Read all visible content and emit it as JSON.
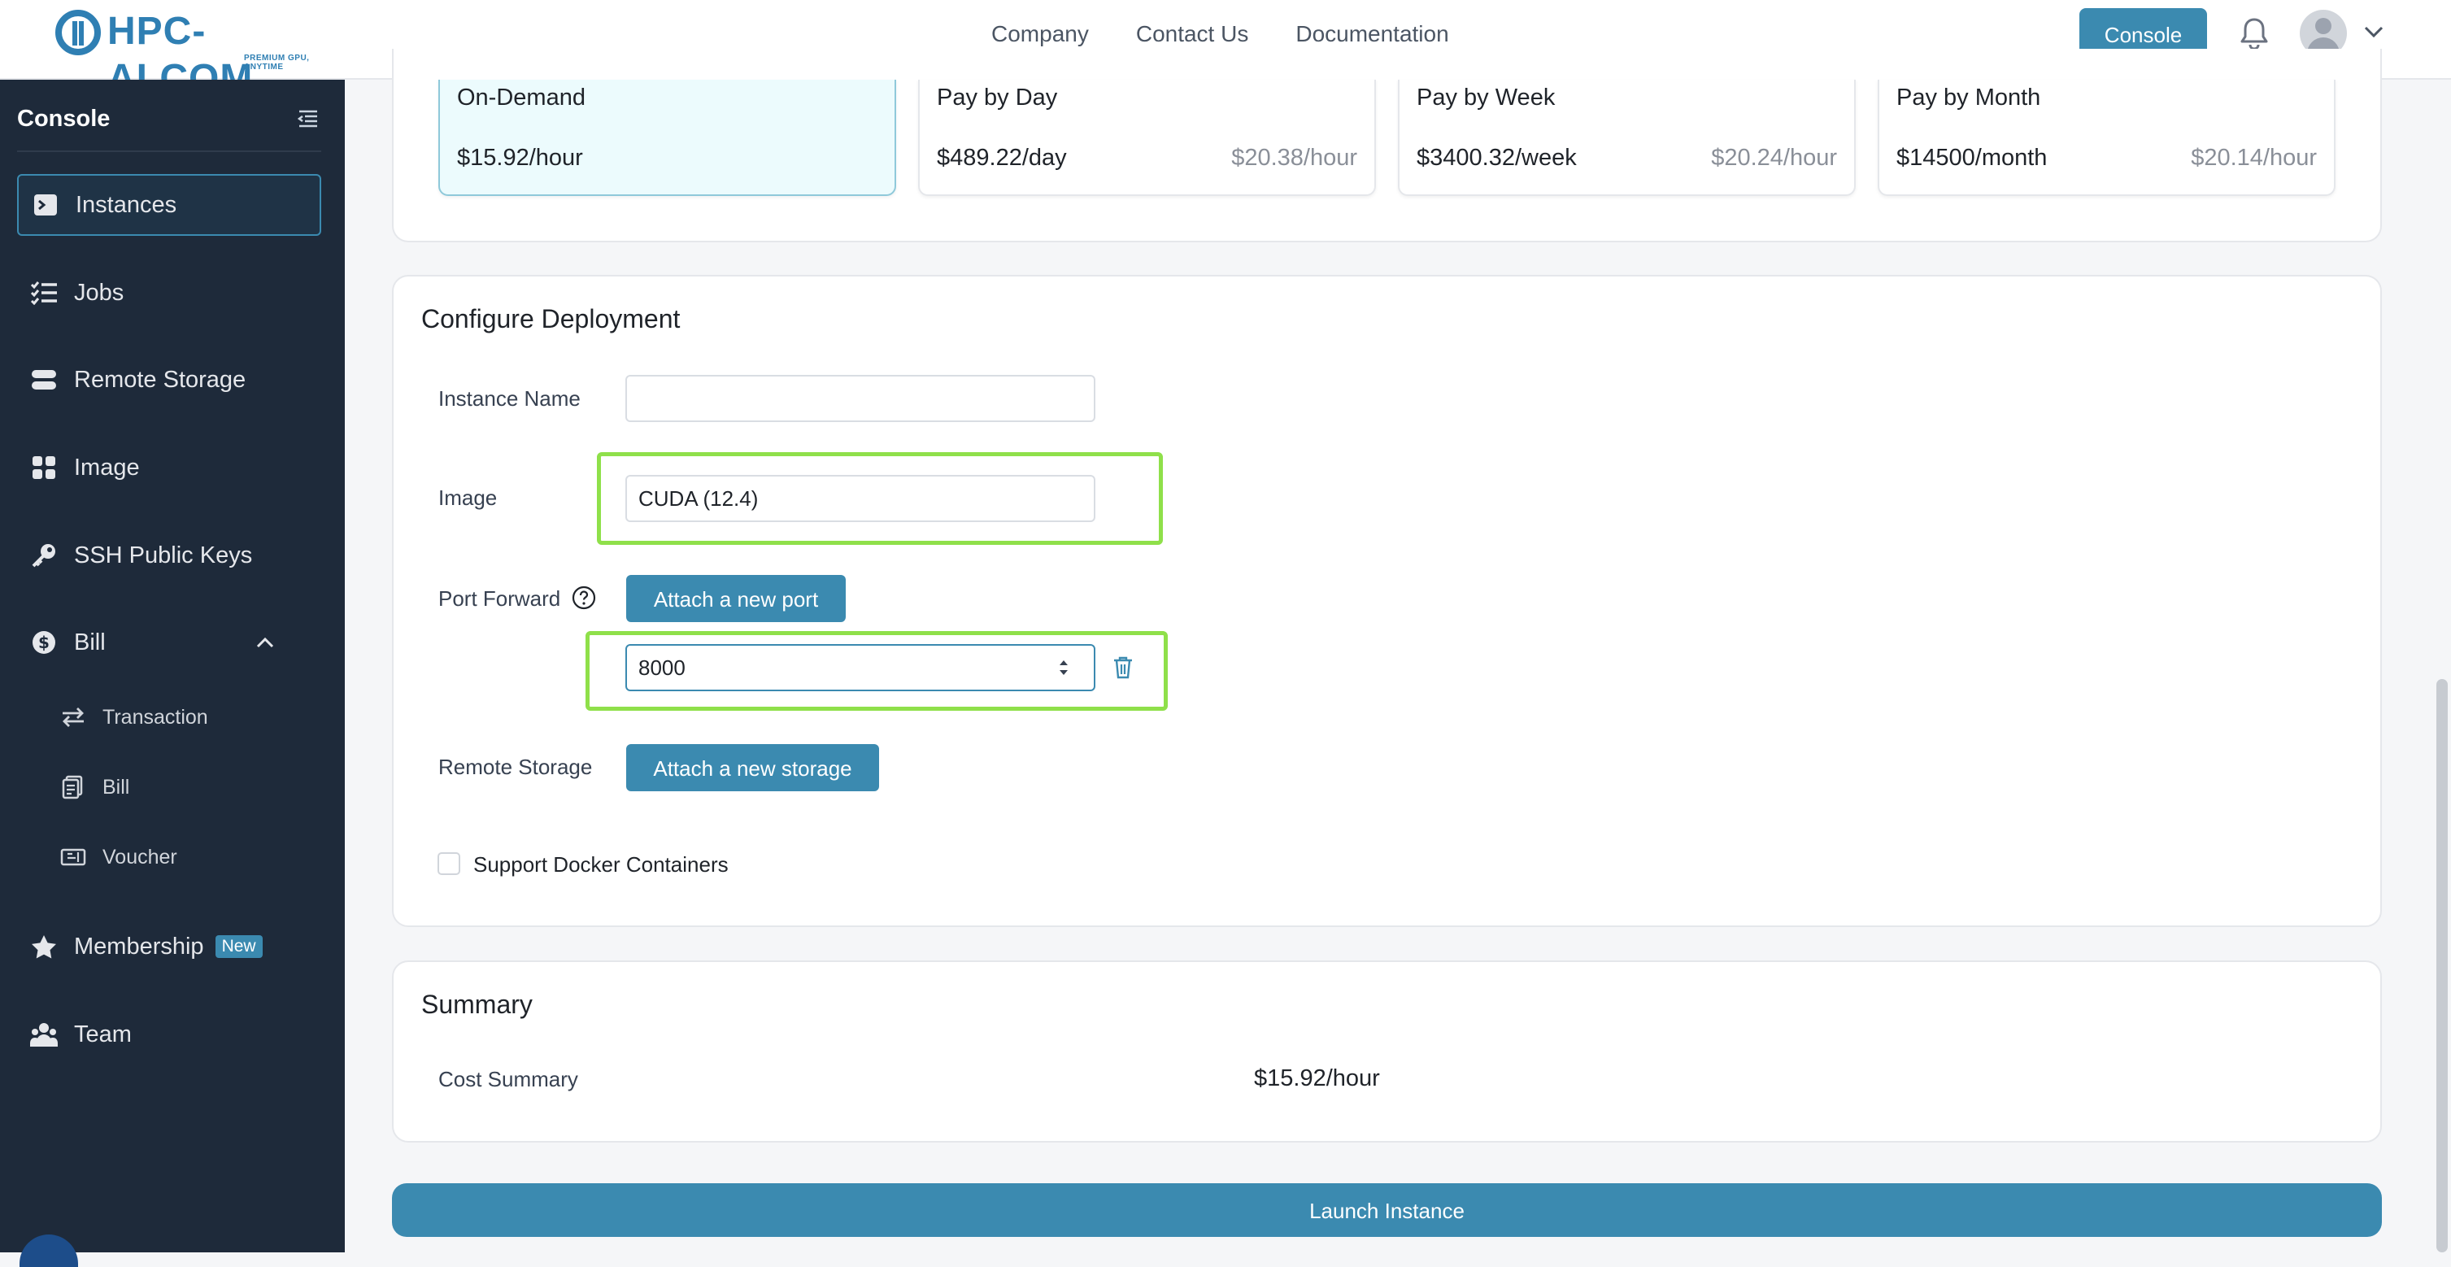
{
  "brand": {
    "name": "HPC-AI.COM",
    "tagline": "PREMIUM GPU, ANYTIME"
  },
  "topnav": {
    "links": [
      "Company",
      "Contact Us",
      "Documentation"
    ],
    "console_label": "Console"
  },
  "sidebar": {
    "title": "Console",
    "items": [
      {
        "label": "Instances",
        "icon": "terminal-icon"
      },
      {
        "label": "Jobs",
        "icon": "checklist-icon"
      },
      {
        "label": "Remote Storage",
        "icon": "storage-icon"
      },
      {
        "label": "Image",
        "icon": "grid-icon"
      },
      {
        "label": "SSH Public Keys",
        "icon": "key-icon"
      },
      {
        "label": "Bill",
        "icon": "dollar-icon"
      },
      {
        "label": "Membership",
        "icon": "star-icon",
        "badge": "New"
      },
      {
        "label": "Team",
        "icon": "team-icon"
      }
    ],
    "bill_sub": [
      {
        "label": "Transaction",
        "icon": "arrows-icon"
      },
      {
        "label": "Bill",
        "icon": "receipt-icon"
      },
      {
        "label": "Voucher",
        "icon": "ticket-icon"
      }
    ]
  },
  "plans": [
    {
      "name": "On-Demand",
      "price": "$15.92/hour",
      "rate": ""
    },
    {
      "name": "Pay by Day",
      "price": "$489.22/day",
      "rate": "$20.38/hour"
    },
    {
      "name": "Pay by Week",
      "price": "$3400.32/week",
      "rate": "$20.24/hour"
    },
    {
      "name": "Pay by Month",
      "price": "$14500/month",
      "rate": "$20.14/hour"
    }
  ],
  "configure": {
    "title": "Configure Deployment",
    "instance_name_label": "Instance Name",
    "instance_name_value": "",
    "image_label": "Image",
    "image_value": "CUDA (12.4)",
    "port_forward_label": "Port Forward",
    "attach_port_label": "Attach a new port",
    "port_value": "8000",
    "remote_storage_label": "Remote Storage",
    "attach_storage_label": "Attach a new storage",
    "docker_label": "Support Docker Containers"
  },
  "summary": {
    "title": "Summary",
    "cost_label": "Cost Summary",
    "cost_value": "$15.92/hour"
  },
  "launch_label": "Launch Instance",
  "colors": {
    "accent": "#3b8ab0",
    "sidebar_bg": "#1e2a3a",
    "highlight": "#8fe04a",
    "selected_plan_bg": "#ecfbfd"
  }
}
